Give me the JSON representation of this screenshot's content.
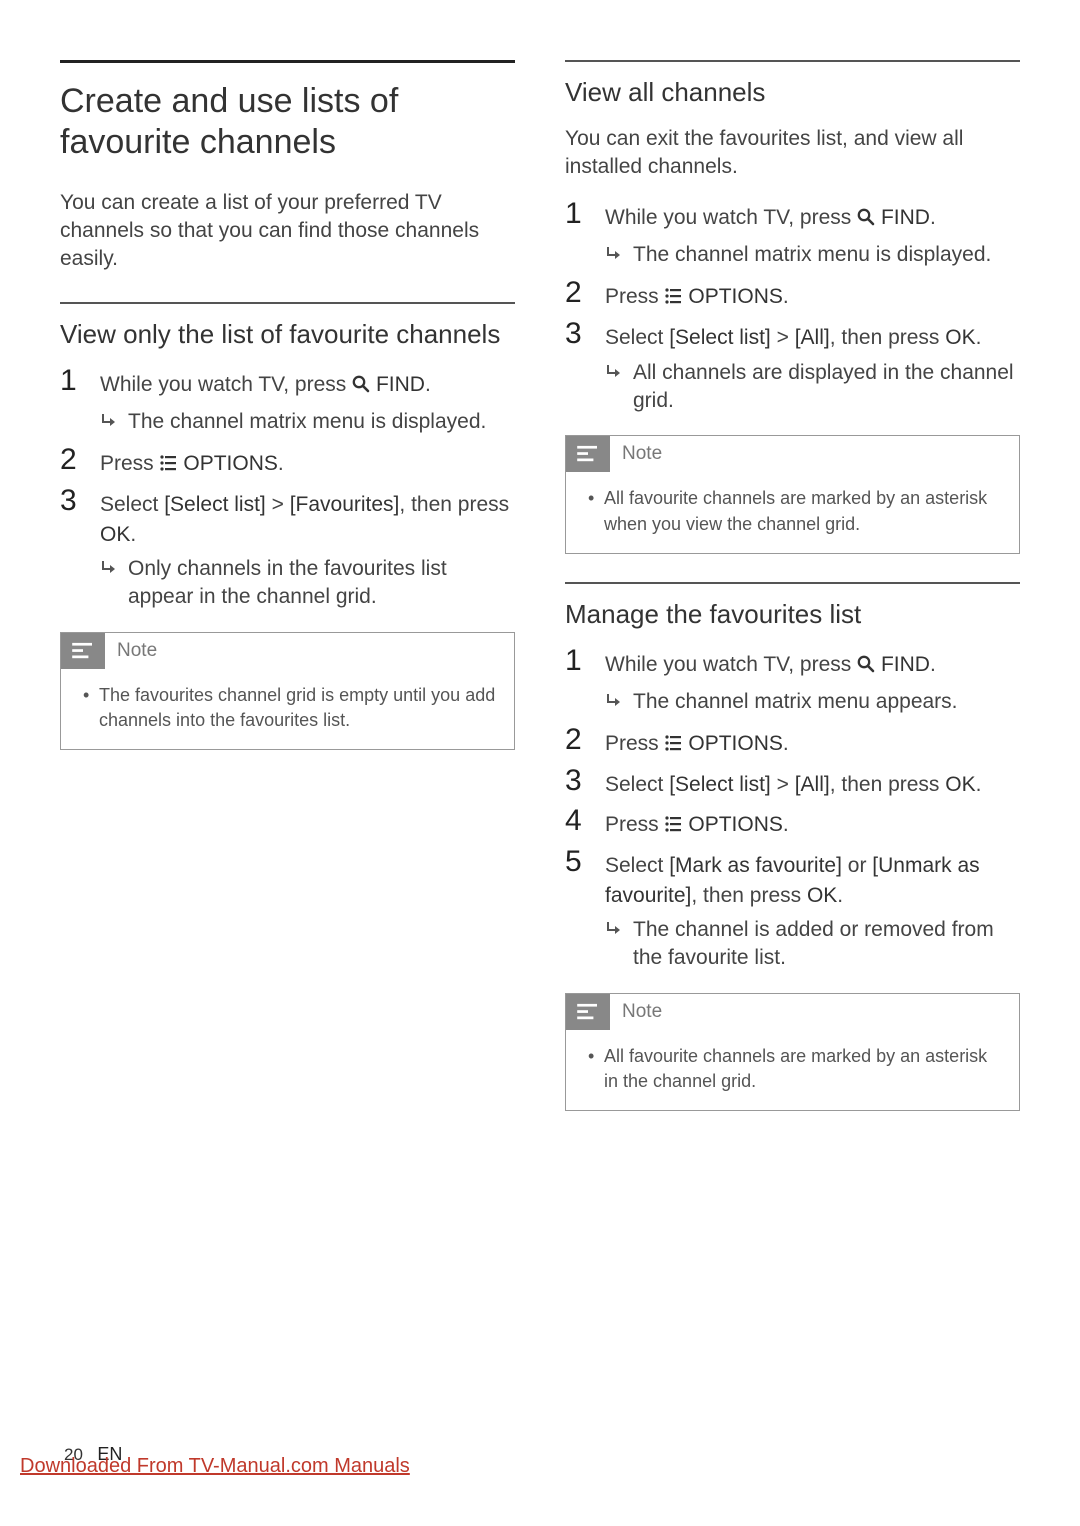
{
  "left": {
    "heading": "Create and use lists of favourite channels",
    "intro": "You can create a list of your preferred TV channels so that you can find those channels easily.",
    "section1": {
      "title": "View only the list of favourite channels",
      "steps": [
        {
          "n": "1",
          "text_pre": "While you watch TV, press ",
          "find": "FIND",
          "text_post": ".",
          "sub": "The channel matrix menu is displayed."
        },
        {
          "n": "2",
          "text_pre": "Press ",
          "options": "OPTIONS",
          "text_post": "."
        },
        {
          "n": "3",
          "select_pre": "Select ",
          "sel1": "[Select list]",
          "gt": " > ",
          "sel2": "[Favourites]",
          "select_post": ", then press ",
          "ok": "OK",
          "dot": ".",
          "sub": "Only channels in the favourites list appear in the channel grid."
        }
      ],
      "note_title": "Note",
      "note_text": "The favourites channel grid is empty until you add channels into the favourites list."
    }
  },
  "right": {
    "section1": {
      "title": "View all channels",
      "intro": "You can exit the favourites list, and view all installed channels.",
      "steps": [
        {
          "n": "1",
          "text_pre": "While you watch TV, press ",
          "find": "FIND",
          "text_post": ".",
          "sub": "The channel matrix menu is displayed."
        },
        {
          "n": "2",
          "text_pre": "Press ",
          "options": "OPTIONS",
          "text_post": "."
        },
        {
          "n": "3",
          "select_pre": "Select ",
          "sel1": "[Select list]",
          "gt": " > ",
          "sel2": "[All]",
          "select_post": ", then press ",
          "ok": "OK",
          "dot": ".",
          "sub": "All channels are displayed in the channel grid."
        }
      ],
      "note_title": "Note",
      "note_text": "All favourite channels are marked by an asterisk when you view the channel grid."
    },
    "section2": {
      "title": "Manage the favourites list",
      "steps": [
        {
          "n": "1",
          "text_pre": "While you watch TV, press ",
          "find": "FIND",
          "text_post": ".",
          "sub": "The channel matrix menu appears."
        },
        {
          "n": "2",
          "text_pre": "Press ",
          "options": "OPTIONS",
          "text_post": "."
        },
        {
          "n": "3",
          "select_pre": "Select ",
          "sel1": "[Select list]",
          "gt": " > ",
          "sel2": "[All]",
          "select_post": ", then press ",
          "ok": "OK",
          "dot": "."
        },
        {
          "n": "4",
          "text_pre": "Press ",
          "options": "OPTIONS",
          "text_post": "."
        },
        {
          "n": "5",
          "select_pre": "Select ",
          "sel1": "[Mark as favourite]",
          "or": " or ",
          "sel2": "[Unmark as favourite]",
          "select_post": ", then press ",
          "ok": "OK",
          "dot": ".",
          "sub": "The channel is added or removed from the favourite list."
        }
      ],
      "note_title": "Note",
      "note_text": "All favourite channels are marked by an asterisk in the channel grid."
    }
  },
  "footer": {
    "page": "20",
    "lang": "EN",
    "download": "Downloaded From TV-Manual.com Manuals"
  }
}
